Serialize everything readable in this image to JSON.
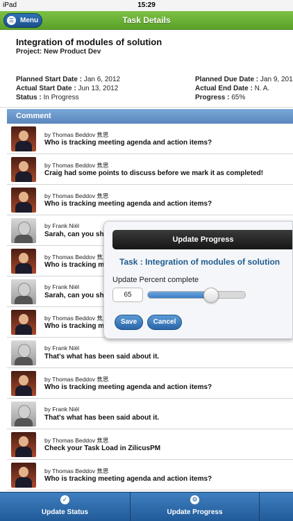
{
  "status_bar": {
    "carrier": "iPad",
    "time": "15:29"
  },
  "header": {
    "menu_label": "Menu",
    "title": "Task Details"
  },
  "task": {
    "title": "Integration of modules of solution",
    "project": "Project: New Product Dev",
    "planned_start_label": "Planned Start Date :",
    "planned_start_value": "Jan 6, 2012",
    "actual_start_label": "Actual Start Date :",
    "actual_start_value": "Jun 13, 2012",
    "status_label": "Status :",
    "status_value": "In Progress",
    "planned_due_label": "Planned Due Date :",
    "planned_due_value": "Jan 9, 201",
    "actual_end_label": "Actual End Date :",
    "actual_end_value": "N. A.",
    "progress_label": "Progress :",
    "progress_value": "65%"
  },
  "comments_header": "Comment",
  "comments": [
    {
      "author": "by Thomas Beddov 焦思",
      "avatar": "tb",
      "text": "Who is tracking meeting agenda and action items?"
    },
    {
      "author": "by Thomas Beddov 焦思",
      "avatar": "tb",
      "text": "Craig had some points to discuss before we mark it as completed!"
    },
    {
      "author": "by Thomas Beddov 焦思",
      "avatar": "tb",
      "text": "Who is tracking meeting agenda and action items?"
    },
    {
      "author": "by Frank Niël",
      "avatar": "fn",
      "text": "Sarah, can you sh"
    },
    {
      "author": "by Thomas Beddov 焦思",
      "avatar": "tb",
      "text": "Who is tracking m"
    },
    {
      "author": "by Frank Niël",
      "avatar": "fn",
      "text": "Sarah, can you sh"
    },
    {
      "author": "by Thomas Beddov 焦思",
      "avatar": "tb",
      "text": "Who is tracking m"
    },
    {
      "author": "by Frank Niël",
      "avatar": "fn",
      "text": "That's what has been said about it."
    },
    {
      "author": "by Thomas Beddov 焦思",
      "avatar": "tb",
      "text": "Who is tracking meeting agenda and action items?"
    },
    {
      "author": "by Frank Niël",
      "avatar": "fn",
      "text": "That's what has been said about it."
    },
    {
      "author": "by Thomas Beddov 焦思",
      "avatar": "tb",
      "text": "Check your Task Load in ZilicusPM"
    },
    {
      "author": "by Thomas Beddov 焦思",
      "avatar": "tb",
      "text": "Who is tracking meeting agenda and action items?"
    }
  ],
  "dialog": {
    "title": "Update Progress",
    "task_line": "Task : Integration of modules of solution",
    "percent_label": "Update Percent complete",
    "percent_value": "65",
    "slider_fraction": 0.65,
    "save_label": "Save",
    "cancel_label": "Cancel"
  },
  "tabbar": {
    "update_status_label": "Update Status",
    "update_status_icon": "check-icon",
    "update_progress_label": "Update Progress",
    "update_progress_icon": "gear-icon"
  }
}
